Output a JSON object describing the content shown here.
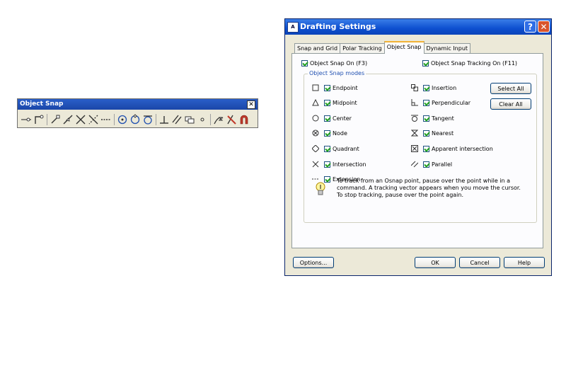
{
  "toolbar": {
    "title": "Object Snap",
    "close": "✕",
    "icons": [
      "temporary-tracking-icon",
      "snap-from-icon",
      "endpoint-icon",
      "midpoint-icon",
      "intersection-icon",
      "apparent-intersection-icon",
      "extension-icon",
      "center-icon",
      "quadrant-icon",
      "tangent-icon",
      "perpendicular-icon",
      "parallel-icon",
      "insert-icon",
      "node-icon",
      "nearest-icon",
      "snap-none-icon",
      "osnap-settings-icon"
    ]
  },
  "dialog": {
    "title": "Drafting Settings",
    "help_glyph": "?",
    "close_glyph": "✕",
    "tabs": [
      {
        "label": "Snap and Grid",
        "active": false
      },
      {
        "label": "Polar Tracking",
        "active": false
      },
      {
        "label": "Object Snap",
        "active": true
      },
      {
        "label": "Dynamic Input",
        "active": false
      }
    ],
    "snap_on": {
      "label": "Object Snap On (F3)",
      "checked": true
    },
    "tracking_on": {
      "label": "Object Snap Tracking On (F11)",
      "checked": true
    },
    "modes_group": "Object Snap modes",
    "modes_left": [
      {
        "label": "Endpoint",
        "checked": true,
        "icon": "endpoint-icon"
      },
      {
        "label": "Midpoint",
        "checked": true,
        "icon": "midpoint-icon"
      },
      {
        "label": "Center",
        "checked": true,
        "icon": "center-icon"
      },
      {
        "label": "Node",
        "checked": true,
        "icon": "node-icon"
      },
      {
        "label": "Quadrant",
        "checked": true,
        "icon": "quadrant-icon"
      },
      {
        "label": "Intersection",
        "checked": true,
        "icon": "intersection-icon"
      },
      {
        "label": "Extension",
        "checked": true,
        "icon": "extension-icon"
      }
    ],
    "modes_right": [
      {
        "label": "Insertion",
        "checked": true,
        "icon": "insertion-icon"
      },
      {
        "label": "Perpendicular",
        "checked": true,
        "icon": "perpendicular-icon"
      },
      {
        "label": "Tangent",
        "checked": true,
        "icon": "tangent-icon"
      },
      {
        "label": "Nearest",
        "checked": true,
        "icon": "nearest-icon"
      },
      {
        "label": "Apparent intersection",
        "checked": true,
        "icon": "apparent-intersection-icon"
      },
      {
        "label": "Parallel",
        "checked": true,
        "icon": "parallel-icon"
      }
    ],
    "select_all": "Select All",
    "clear_all": "Clear All",
    "tip_lines": [
      "To track from an Osnap point, pause over the point while in a",
      "command.  A tracking vector appears when you move the cursor.",
      "To stop tracking, pause over the point again."
    ],
    "buttons": {
      "options": "Options...",
      "ok": "OK",
      "cancel": "Cancel",
      "help": "Help"
    },
    "colors": {
      "title_bar": "#0d4fd0",
      "face": "#ece9d8",
      "check": "#21a121",
      "group_label": "#1f4fb0"
    }
  }
}
